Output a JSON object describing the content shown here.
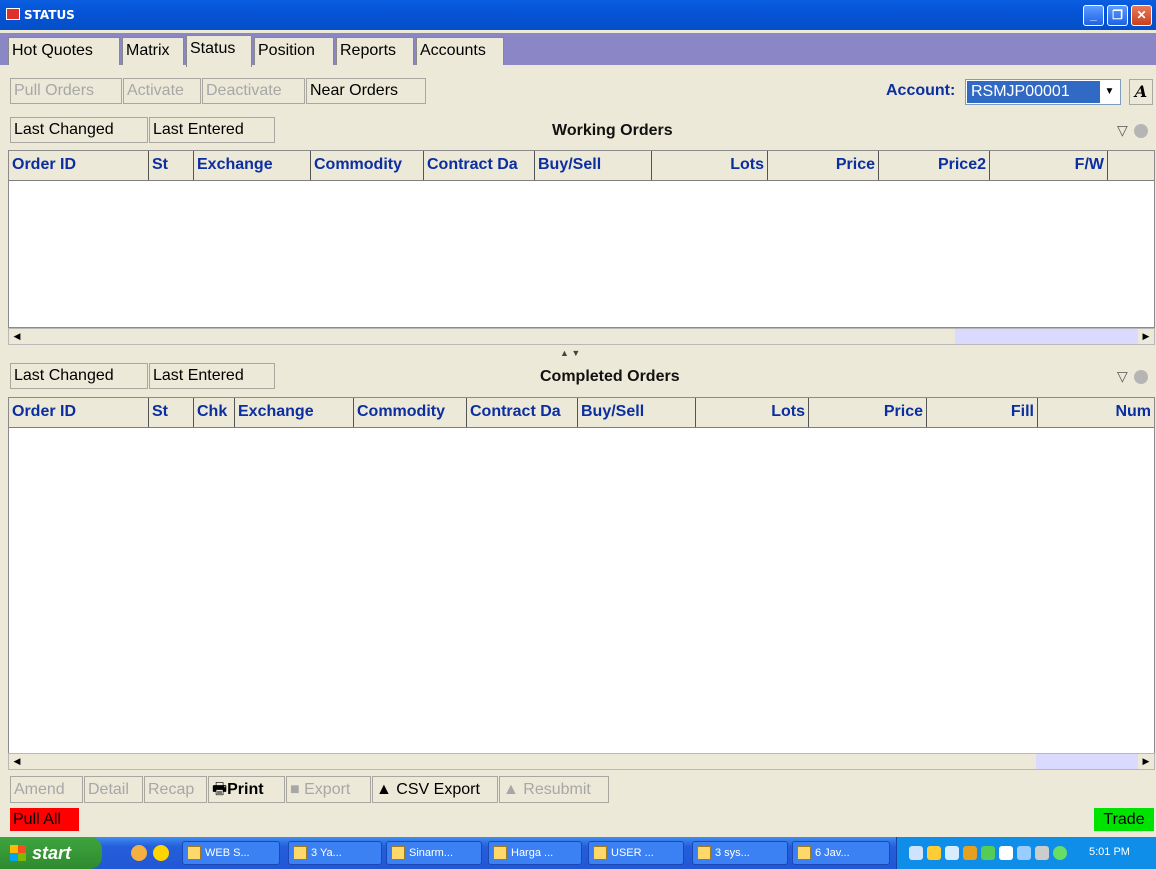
{
  "window": {
    "title": "STATUS"
  },
  "tabs": [
    "Hot Quotes",
    "Matrix",
    "Status",
    "Position",
    "Reports",
    "Accounts"
  ],
  "active_tab": "Status",
  "toolbar": {
    "pull_orders": "Pull Orders",
    "activate": "Activate",
    "deactivate": "Deactivate",
    "near_orders": "Near Orders"
  },
  "account": {
    "label": "Account:",
    "value": "RSMJP00001",
    "font_button": "A"
  },
  "working": {
    "last_changed": "Last Changed",
    "last_entered": "Last Entered",
    "title": "Working Orders",
    "columns": [
      "Order ID",
      "St",
      "Exchange",
      "Commodity",
      "Contract Da",
      "Buy/Sell",
      "Lots",
      "Price",
      "Price2",
      "F/W"
    ]
  },
  "completed": {
    "last_changed": "Last Changed",
    "last_entered": "Last Entered",
    "title": "Completed Orders",
    "columns": [
      "Order ID",
      "St",
      "Chk",
      "Exchange",
      "Commodity",
      "Contract Da",
      "Buy/Sell",
      "Lots",
      "Price",
      "Fill",
      "Num"
    ]
  },
  "bottom_buttons": {
    "amend": "Amend",
    "detail": "Detail",
    "recap": "Recap",
    "print": "Print",
    "export": "Export",
    "csv_export": "CSV Export",
    "resubmit": "Resubmit"
  },
  "pull_all": "Pull All",
  "trade": "Trade",
  "taskbar": {
    "start": "start",
    "tasks": [
      "WEB S...",
      "3 Ya...",
      "Sinarm...",
      "Harga ...",
      "USER ...",
      "3 sys...",
      "6 Jav..."
    ],
    "clock": "5:01 PM"
  },
  "colors": {
    "header_text": "#0b2ea0",
    "pull_all": "#ff0000",
    "trade": "#00e200",
    "tab_strip": "#8b87c7"
  }
}
